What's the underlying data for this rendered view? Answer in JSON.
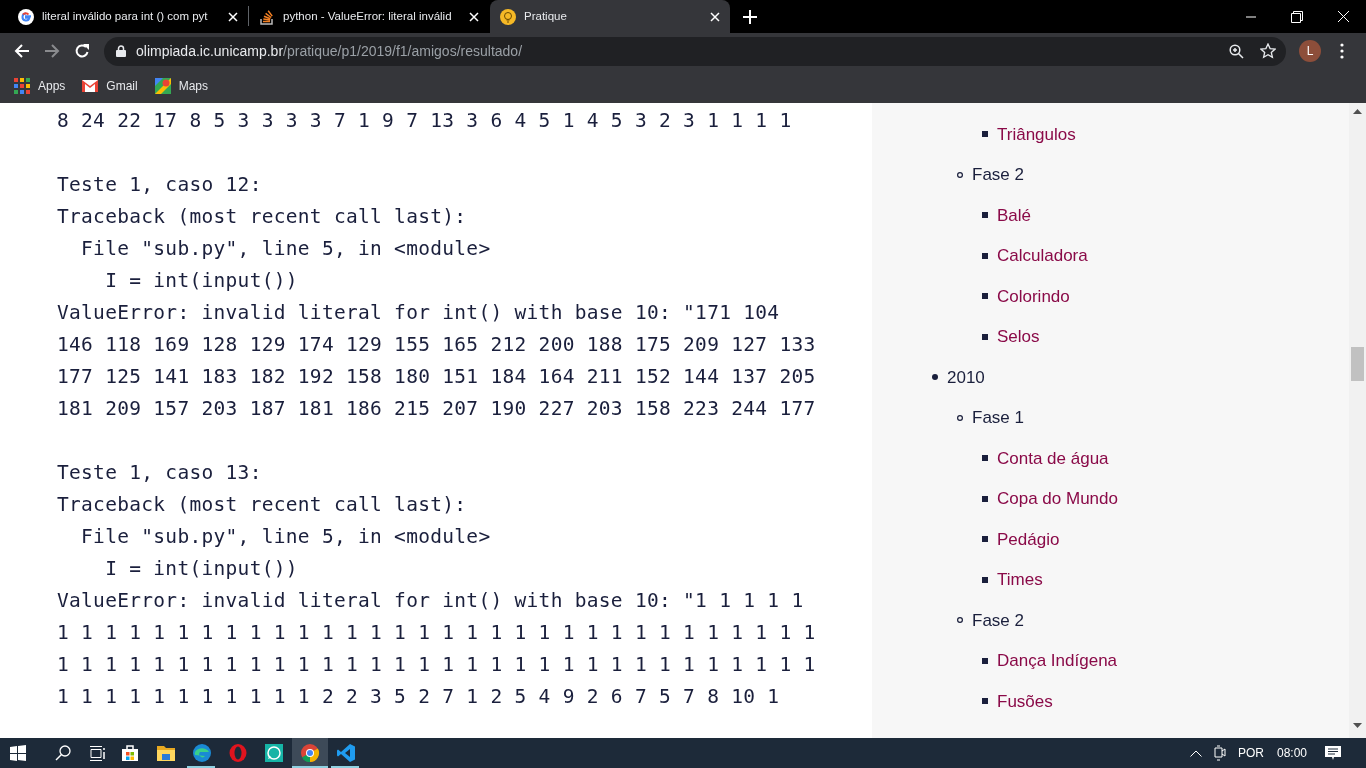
{
  "browser": {
    "tabs": [
      {
        "kind": "google",
        "title": "literal inválido para int () com pyt",
        "selected": false
      },
      {
        "kind": "stack",
        "title": "python - ValueError: literal inválid",
        "selected": false
      },
      {
        "kind": "bulb",
        "title": "Pratique",
        "selected": true
      }
    ],
    "url": {
      "host": "olimpiada.ic.unicamp.br",
      "path": "/pratique/p1/2019/f1/amigos/resultado/"
    },
    "profile": "L",
    "bookmarks": [
      {
        "kind": "apps",
        "label": "Apps"
      },
      {
        "kind": "gmail",
        "label": "Gmail"
      },
      {
        "kind": "maps",
        "label": "Maps"
      }
    ]
  },
  "output": [
    {
      "lines": [
        "8 24 22 17 8 5 3 3 3 3 7 1 9 7 13 3 6 4 5 1 4 5 3 2 3 1 1 1 1"
      ]
    },
    {
      "lines": [
        "Teste 1, caso 12:",
        "Traceback (most recent call last):",
        "  File \"sub.py\", line 5, in <module>",
        "    I = int(input())",
        "ValueError: invalid literal for int() with base 10: \"171 104",
        "146 118 169 128 129 174 129 155 165 212 200 188 175 209 127 133",
        "177 125 141 183 182 192 158 180 151 184 164 211 152 144 137 205",
        "181 209 157 203 187 181 186 215 207 190 227 203 158 223 244 177"
      ]
    },
    {
      "lines": [
        "Teste 1, caso 13:",
        "Traceback (most recent call last):",
        "  File \"sub.py\", line 5, in <module>",
        "    I = int(input())",
        "ValueError: invalid literal for int() with base 10: \"1 1 1 1 1",
        "1 1 1 1 1 1 1 1 1 1 1 1 1 1 1 1 1 1 1 1 1 1 1 1 1 1 1 1 1 1 1 1",
        "1 1 1 1 1 1 1 1 1 1 1 1 1 1 1 1 1 1 1 1 1 1 1 1 1 1 1 1 1 1 1 1",
        "1 1 1 1 1 1 1 1 1 1 1 2 2 3 5 2 7 1 2 5 4 9 2 6 7 5 7 8 10 1"
      ]
    }
  ],
  "sidebar": {
    "tree": [
      {
        "children": [
          {
            "children": [
              {
                "label": "Triângulos"
              }
            ]
          },
          {
            "label": "Fase 2",
            "children": [
              {
                "label": "Balé"
              },
              {
                "label": "Calculadora"
              },
              {
                "label": "Colorindo"
              },
              {
                "label": "Selos"
              }
            ]
          }
        ]
      },
      {
        "label": "2010",
        "children": [
          {
            "label": "Fase 1",
            "children": [
              {
                "label": "Conta de água"
              },
              {
                "label": "Copa do Mundo"
              },
              {
                "label": "Pedágio"
              },
              {
                "label": "Times"
              }
            ]
          },
          {
            "label": "Fase 2",
            "children": [
              {
                "label": "Dança Indígena"
              },
              {
                "label": "Fusões"
              }
            ]
          }
        ]
      }
    ]
  },
  "taskbar": {
    "apps": [
      {
        "kind": "store",
        "running": false,
        "selected": false
      },
      {
        "kind": "files",
        "running": false,
        "selected": false
      },
      {
        "kind": "edge",
        "running": true,
        "selected": false
      },
      {
        "kind": "opera",
        "running": false,
        "selected": false
      },
      {
        "kind": "whatsapp",
        "running": false,
        "selected": false
      },
      {
        "kind": "chrome",
        "running": true,
        "selected": true
      },
      {
        "kind": "vscode",
        "running": true,
        "selected": false
      }
    ],
    "language": "POR",
    "time": "08:00"
  }
}
